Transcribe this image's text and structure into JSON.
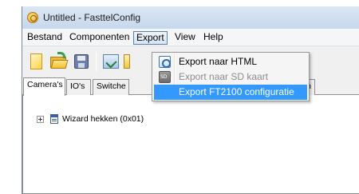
{
  "window": {
    "title": "Untitled - FasttelConfig"
  },
  "menubar": {
    "items": [
      {
        "label": "Bestand"
      },
      {
        "label": "Componenten"
      },
      {
        "label": "Export"
      },
      {
        "label": "View"
      },
      {
        "label": "Help"
      }
    ],
    "active": "Export"
  },
  "toolbar": {
    "buttons": [
      {
        "icon": "new-file-icon"
      },
      {
        "icon": "open-folder-icon"
      },
      {
        "icon": "save-icon"
      },
      {
        "icon": "connect-icon"
      },
      {
        "icon": "partial-icon"
      }
    ]
  },
  "tabs": {
    "items": [
      {
        "label": "Camera's"
      },
      {
        "label": "IO's"
      },
      {
        "label": "Switche"
      },
      {
        "label": "sten"
      }
    ],
    "selected": "Camera's"
  },
  "tree": {
    "nodes": [
      {
        "label": "Wizard hekken (0x01)",
        "expanded": false,
        "icon": "device-icon"
      }
    ]
  },
  "export_menu": {
    "items": [
      {
        "label": "Export naar HTML",
        "enabled": true,
        "highlighted": false,
        "icon": "html-export-icon"
      },
      {
        "label": "Export naar SD kaart",
        "enabled": false,
        "highlighted": false,
        "icon": "sd-card-icon"
      },
      {
        "label": "Export FT2100 configuratie",
        "enabled": true,
        "highlighted": true,
        "icon": ""
      }
    ]
  },
  "colors": {
    "highlight": "#3399ff",
    "disabled_text": "#8d8d8d"
  }
}
